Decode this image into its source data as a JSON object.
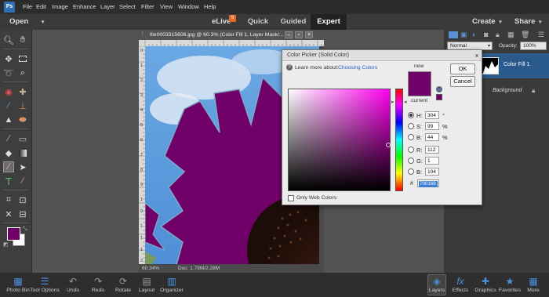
{
  "menubar": {
    "logo_text": "Ps",
    "items": [
      "File",
      "Edit",
      "Image",
      "Enhance",
      "Layer",
      "Select",
      "Filter",
      "View",
      "Window",
      "Help"
    ]
  },
  "modebar": {
    "open_label": "Open",
    "elive_label": "eLive",
    "elive_badge": "9",
    "tabs": [
      "Quick",
      "Guided",
      "Expert"
    ],
    "create_label": "Create",
    "share_label": "Share"
  },
  "document": {
    "title": "file0003315606.jpg @ 60.3% (Color Fill 1, Layer Mask/...",
    "zoom": "60.34%",
    "doc_size": "Doc: 1.78M/2.28M",
    "ruler_left_numbers": [
      "0",
      "1",
      "2",
      "3",
      "4",
      "5",
      "6",
      "7",
      "8",
      "9",
      "1",
      "0",
      "1",
      "1",
      "1",
      "2"
    ]
  },
  "layers_panel": {
    "blend_mode": "Normal",
    "opacity_label": "Opacity:",
    "opacity_value": "100%",
    "layers": [
      "Color Fill 1",
      "Background"
    ]
  },
  "color_picker": {
    "title": "Color Picker (Solid Color)",
    "learn_more_text": "Learn more about:",
    "learn_more_link": "Choosing Colors",
    "new_label": "new",
    "current_label": "current",
    "ok_label": "OK",
    "cancel_label": "Cancel",
    "fields": [
      {
        "label": "H:",
        "value": "304",
        "unit": "°"
      },
      {
        "label": "S:",
        "value": "99",
        "unit": "%"
      },
      {
        "label": "B:",
        "value": "44",
        "unit": "%"
      },
      {
        "label": "R:",
        "value": "112",
        "unit": ""
      },
      {
        "label": "G:",
        "value": "1",
        "unit": ""
      },
      {
        "label": "B:",
        "value": "104",
        "unit": ""
      }
    ],
    "hex_label": "#",
    "hex_value": "700168",
    "only_web_colors_label": "Only Web Colors",
    "selected_color": "#700168",
    "hue_color": "#ff00ee"
  },
  "bottombar": {
    "items": [
      "Photo Bin",
      "Tool Options",
      "Undo",
      "Redo",
      "Rotate",
      "Layout",
      "Organizer"
    ],
    "right_items": [
      "Layers",
      "Effects",
      "Graphics",
      "Favorites",
      "More"
    ]
  },
  "colors": {
    "accent": "#2f6fb6",
    "foreground_swatch": "#700168",
    "background_swatch": "#ffffff"
  }
}
